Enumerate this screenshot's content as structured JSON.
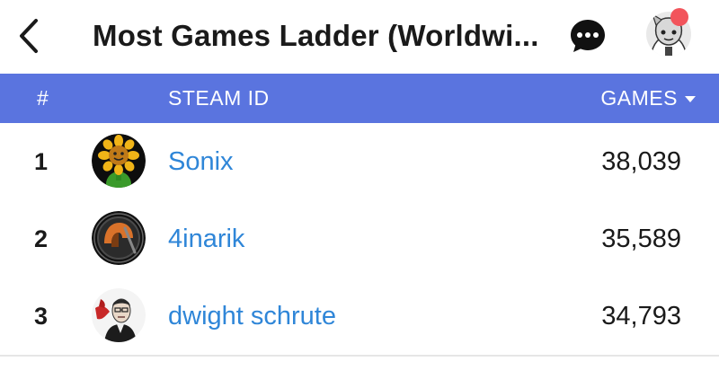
{
  "header": {
    "title": "Most Games Ladder (Worldwi...",
    "back_icon": "chevron-left-icon",
    "chat_icon": "chat-bubble-icon",
    "avatar_icon": "user-avatar",
    "notification_color": "#f2545b"
  },
  "table": {
    "header_bg": "#5a74df",
    "columns": {
      "rank": "#",
      "steam_id": "STEAM ID",
      "games": "GAMES"
    },
    "sort_icon": "caret-down-icon",
    "rows": [
      {
        "rank": "1",
        "name": "Sonix",
        "games": "38,039",
        "avatar_icon": "sunflower-avatar"
      },
      {
        "rank": "2",
        "name": "4inarik",
        "games": "35,589",
        "avatar_icon": "orange-helmet-avatar"
      },
      {
        "rank": "3",
        "name": "dwight schrute",
        "games": "34,793",
        "avatar_icon": "portrait-avatar"
      }
    ]
  },
  "colors": {
    "link": "#2f86d8",
    "text": "#1a1a1a"
  }
}
